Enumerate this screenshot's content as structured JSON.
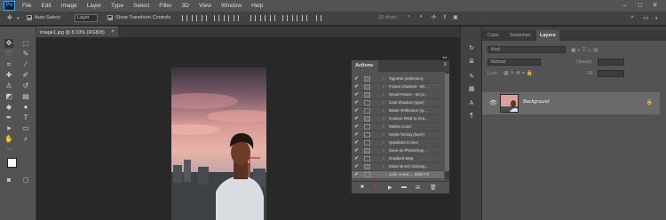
{
  "menubar": {
    "logo": "Ps",
    "items": [
      "File",
      "Edit",
      "Image",
      "Layer",
      "Type",
      "Select",
      "Filter",
      "3D",
      "View",
      "Window",
      "Help"
    ],
    "window_controls": [
      "–",
      "□",
      "✕"
    ]
  },
  "options": {
    "auto_select_label": "Auto-Select:",
    "auto_select_value": "Layer",
    "show_transform_label": "Show Transform Controls",
    "mode_3d": "3D Mode:"
  },
  "document": {
    "tab_title": "image1.jpg @ 8.33% (RGB/8)",
    "close_glyph": "×"
  },
  "actions_panel": {
    "title": "Actions",
    "rows": [
      {
        "label": "Vignette (selection)",
        "dialog": true
      },
      {
        "label": "Frame Channel - 50 ...",
        "dialog": true
      },
      {
        "label": "Wood Frame - 50 pi...",
        "dialog": true
      },
      {
        "label": "Cast Shadow (type)",
        "dialog": false
      },
      {
        "label": "Water Reflection (ty...",
        "dialog": false
      },
      {
        "label": "Custom RGB to Gra...",
        "dialog": true
      },
      {
        "label": "Molten Lead",
        "dialog": false
      },
      {
        "label": "Sepia Toning (layer)",
        "dialog": false
      },
      {
        "label": "Quadrant Colors",
        "dialog": false
      },
      {
        "label": "Save as Photoshop ...",
        "dialog": true
      },
      {
        "label": "Gradient Map",
        "dialog": false
      },
      {
        "label": "Mixer Brush Cloning...",
        "dialog": true
      },
      {
        "label": "color correc... Shift+F2",
        "dialog": false,
        "selected": true
      }
    ]
  },
  "layers_panel": {
    "tabs": [
      "Color",
      "Swatches",
      "Layers"
    ],
    "active_tab": "Layers",
    "kind_placeholder": "Kind",
    "blend_mode": "Normal",
    "opacity_label": "Opacity:",
    "lock_label": "Lock:",
    "fill_label": "Fill:",
    "layer_name": "Background"
  },
  "colors": {
    "accent": "#31a8ff",
    "panel": "#535353",
    "dark": "#282828"
  }
}
